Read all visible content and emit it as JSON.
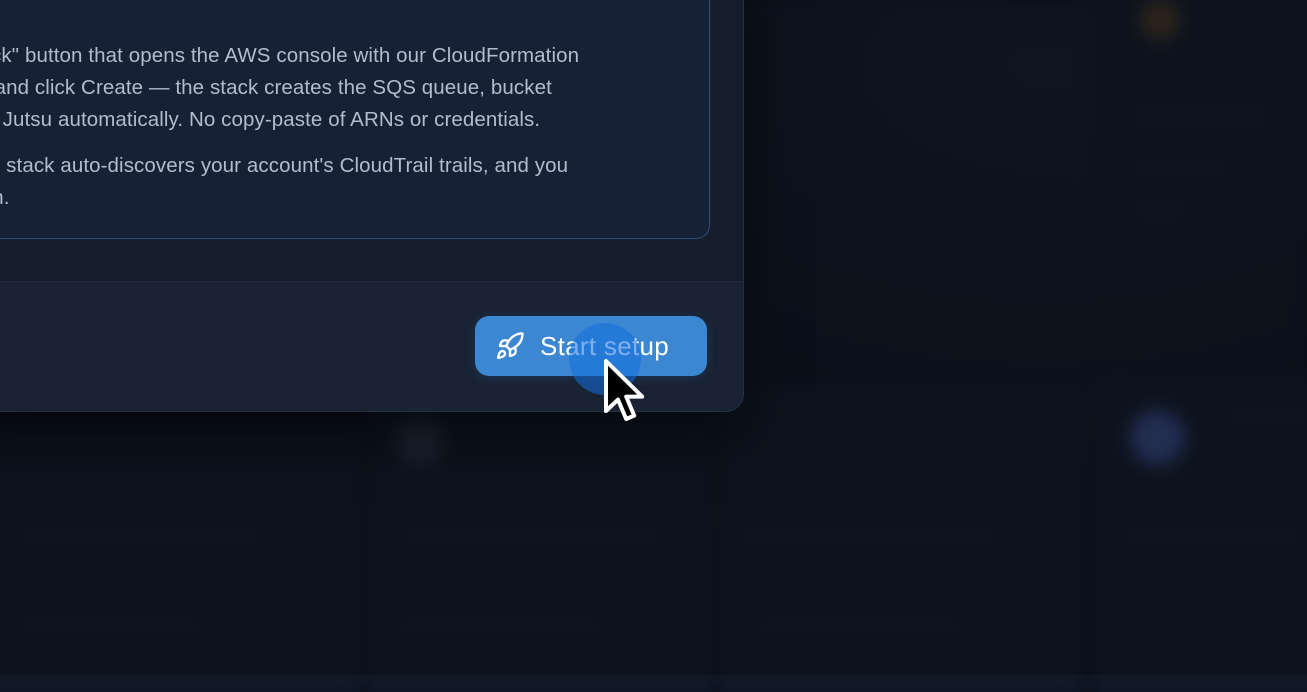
{
  "dialog": {
    "paragraph_1": "Stack\" button that opens the AWS console with our CloudFormation\non, and click Create — the stack creates the SQS queue, bucket\nwith Jutsu automatically. No copy-paste of ARNs or credentials.",
    "paragraph_2": ", the stack auto-discovers your account's CloudTrail trails, and you\nction."
  },
  "footer": {
    "start_button_label": "Start setup",
    "start_button_icon": "rocket-icon"
  },
  "colors": {
    "accent": "#3b87d1",
    "click_ripple": "#1f6fd6",
    "dialog_bg": "#161e2c",
    "info_border": "#2f4d78"
  },
  "cursor": {
    "icon": "arrow-cursor-icon"
  }
}
